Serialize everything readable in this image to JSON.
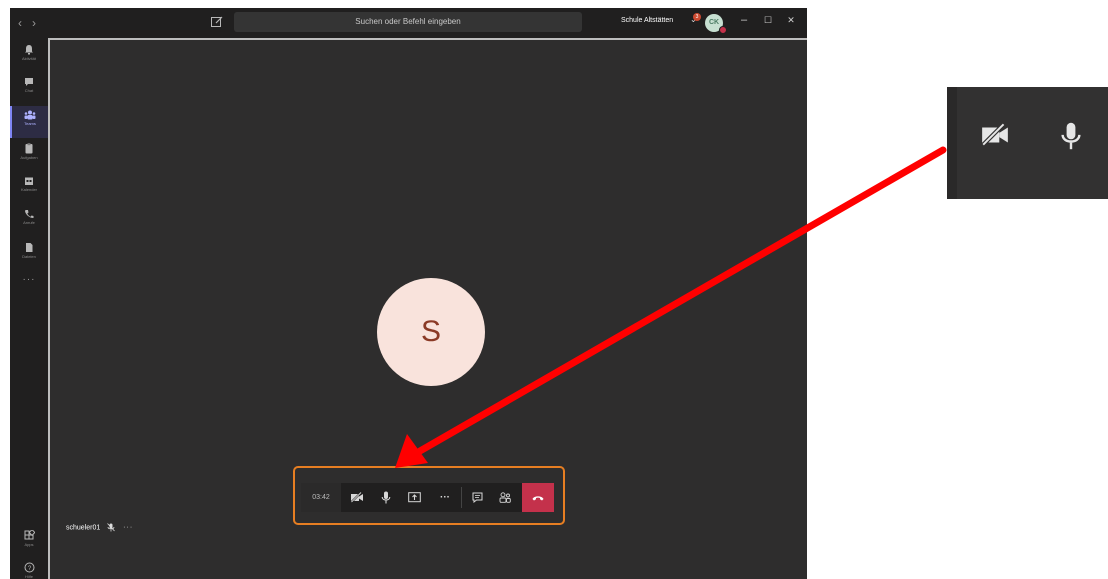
{
  "titlebar": {
    "back_glyph": "‹",
    "forward_glyph": "›",
    "compose_icon": "compose-icon",
    "search_placeholder": "Suchen oder Befehl eingeben",
    "org_name": "Schule Altstätten",
    "notification_count": "3",
    "user_initials": "CK",
    "minimize_glyph": "–",
    "maximize_glyph": "☐",
    "close_glyph": "✕"
  },
  "rail": {
    "items": [
      {
        "label": "Aktivität",
        "icon": "bell-icon"
      },
      {
        "label": "Chat",
        "icon": "chat-icon"
      },
      {
        "label": "Teams",
        "icon": "teams-icon",
        "active": true
      },
      {
        "label": "Aufgaben",
        "icon": "assignments-icon"
      },
      {
        "label": "Kalender",
        "icon": "calendar-icon"
      },
      {
        "label": "Anrufe",
        "icon": "phone-icon"
      },
      {
        "label": "Dateien",
        "icon": "files-icon"
      }
    ],
    "more": "···",
    "bottom": [
      {
        "label": "Apps",
        "icon": "apps-icon"
      },
      {
        "label": "Hilfe",
        "icon": "help-icon"
      }
    ]
  },
  "stage": {
    "avatar_initial": "S",
    "participant_name": "schueler01",
    "participant_more": "···"
  },
  "call_controls": {
    "timer": "03:42",
    "buttons": [
      "camera-off-icon",
      "microphone-icon",
      "share-screen-icon",
      "more-icon",
      "chat-icon",
      "participants-icon",
      "hang-up-icon"
    ],
    "more_glyph": "···"
  },
  "colors": {
    "app_bg": "#201f1f",
    "stage_bg": "#2e2d2d",
    "accent": "#7f85f5",
    "hangup": "#c4314b",
    "highlight": "#e67e22",
    "annotation_arrow": "#ff0000",
    "avatar_bg": "#f9e3dc"
  }
}
